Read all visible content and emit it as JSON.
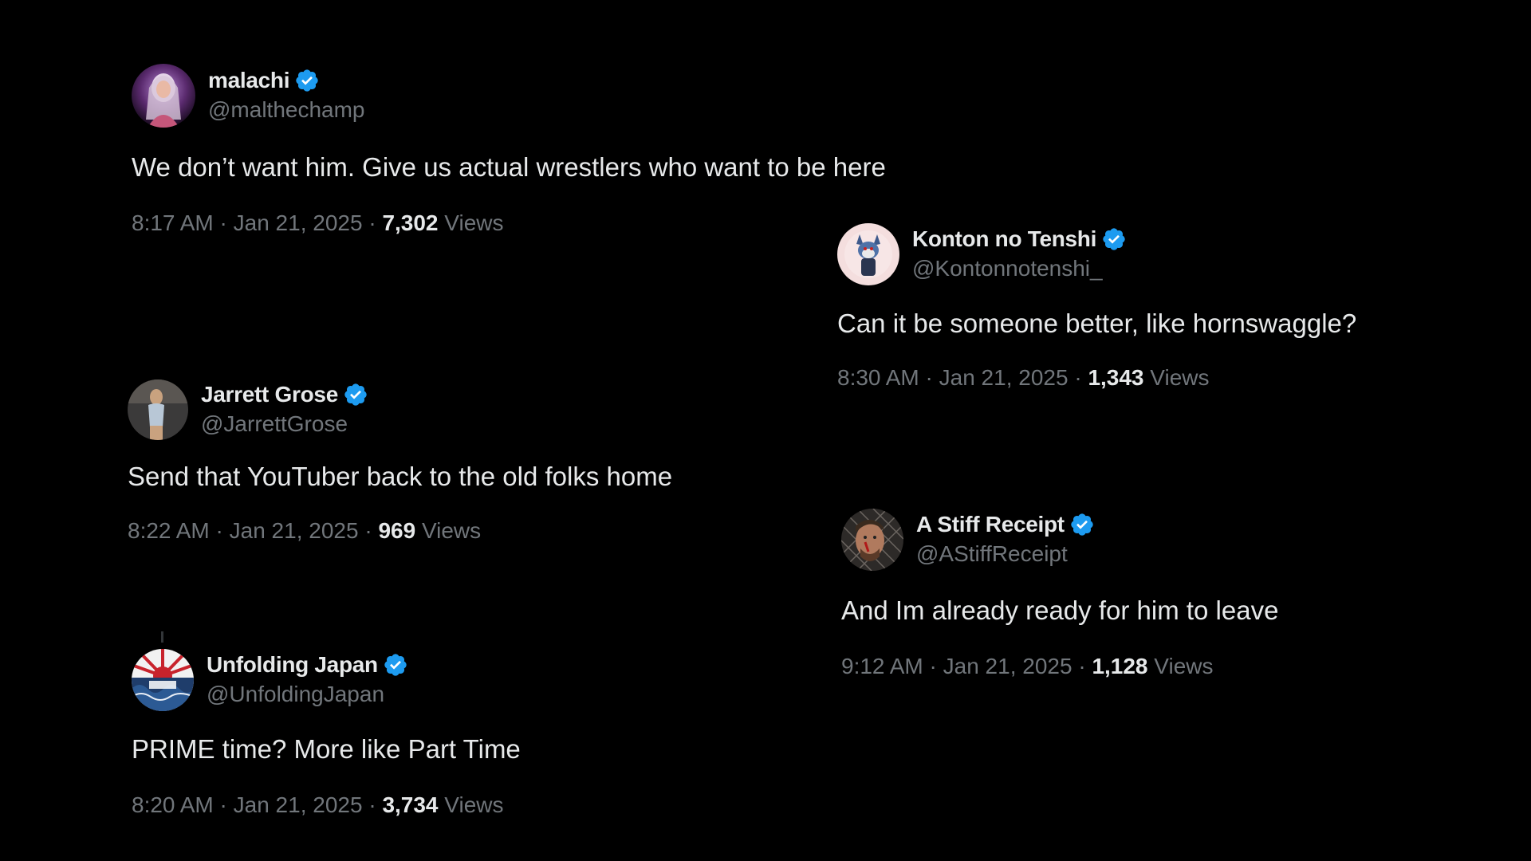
{
  "tweets": [
    {
      "display_name": "malachi",
      "handle": "@malthechamp",
      "text": "We don’t want him. Give us actual wrestlers who want to be here",
      "time": "8:17 AM",
      "date": "Jan 21, 2025",
      "views_count": "7,302",
      "views_label": "Views",
      "verified": true
    },
    {
      "display_name": "Konton no Tenshi",
      "handle": "@Kontonnotenshi_",
      "text": "Can it be someone better, like hornswaggle?",
      "time": "8:30 AM",
      "date": "Jan 21, 2025",
      "views_count": "1,343",
      "views_label": "Views",
      "verified": true
    },
    {
      "display_name": "Jarrett Grose",
      "handle": "@JarrettGrose",
      "text": "Send that YouTuber back to the old folks home",
      "time": "8:22 AM",
      "date": "Jan 21, 2025",
      "views_count": "969",
      "views_label": "Views",
      "verified": true
    },
    {
      "display_name": "A Stiff Receipt",
      "handle": "@AStiffReceipt",
      "text": "And Im already ready for him to leave",
      "time": "9:12 AM",
      "date": "Jan 21, 2025",
      "views_count": "1,128",
      "views_label": "Views",
      "verified": true
    },
    {
      "display_name": "Unfolding Japan",
      "handle": "@UnfoldingJapan",
      "text": "PRIME time? More like Part Time",
      "time": "8:20 AM",
      "date": "Jan 21, 2025",
      "views_count": "3,734",
      "views_label": "Views",
      "verified": true
    }
  ],
  "separator": " · ",
  "icons": {
    "verified": "verified-badge-icon"
  },
  "colors": {
    "background": "#000000",
    "primary_text": "#e7e9ea",
    "secondary_text": "#71767b",
    "verified_blue": "#1d9bf0"
  }
}
